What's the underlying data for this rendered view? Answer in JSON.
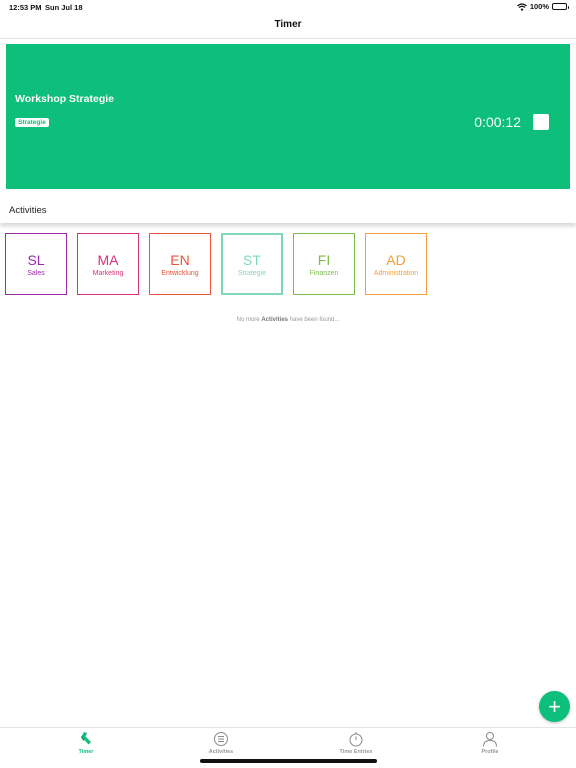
{
  "status_bar": {
    "time": "12:53 PM",
    "date": "Sun Jul 18",
    "battery": "100%"
  },
  "nav": {
    "title": "Timer"
  },
  "running_timer": {
    "activity_name": "Workshop Strategie",
    "tag": "Strategie",
    "elapsed": "0:00:12"
  },
  "activities_section": {
    "title": "Activities"
  },
  "activities": [
    {
      "abbr": "SL",
      "name": "Sales",
      "color": "#9b2aa8",
      "selected": false
    },
    {
      "abbr": "MA",
      "name": "Marketing",
      "color": "#d6337a",
      "selected": false
    },
    {
      "abbr": "EN",
      "name": "Entwicklung",
      "color": "#e8553a",
      "selected": false
    },
    {
      "abbr": "ST",
      "name": "Strategie",
      "color": "#7fd8b7",
      "selected": true
    },
    {
      "abbr": "FI",
      "name": "Finanzen",
      "color": "#7cbe4c",
      "selected": false
    },
    {
      "abbr": "AD",
      "name": "Administration",
      "color": "#f0a03c",
      "selected": false
    }
  ],
  "empty_note": {
    "prefix": "No more ",
    "bold": "Activities",
    "suffix": " have been found..."
  },
  "fab": {
    "icon": "plus-icon",
    "symbol": "+"
  },
  "tabs": [
    {
      "label": "Timer",
      "icon": "timer-icon",
      "active": true
    },
    {
      "label": "Activities",
      "icon": "list-icon",
      "active": false
    },
    {
      "label": "Time Entries",
      "icon": "stopwatch-icon",
      "active": false
    },
    {
      "label": "Profile",
      "icon": "person-icon",
      "active": false
    }
  ],
  "colors": {
    "accent": "#0dbf7a"
  }
}
